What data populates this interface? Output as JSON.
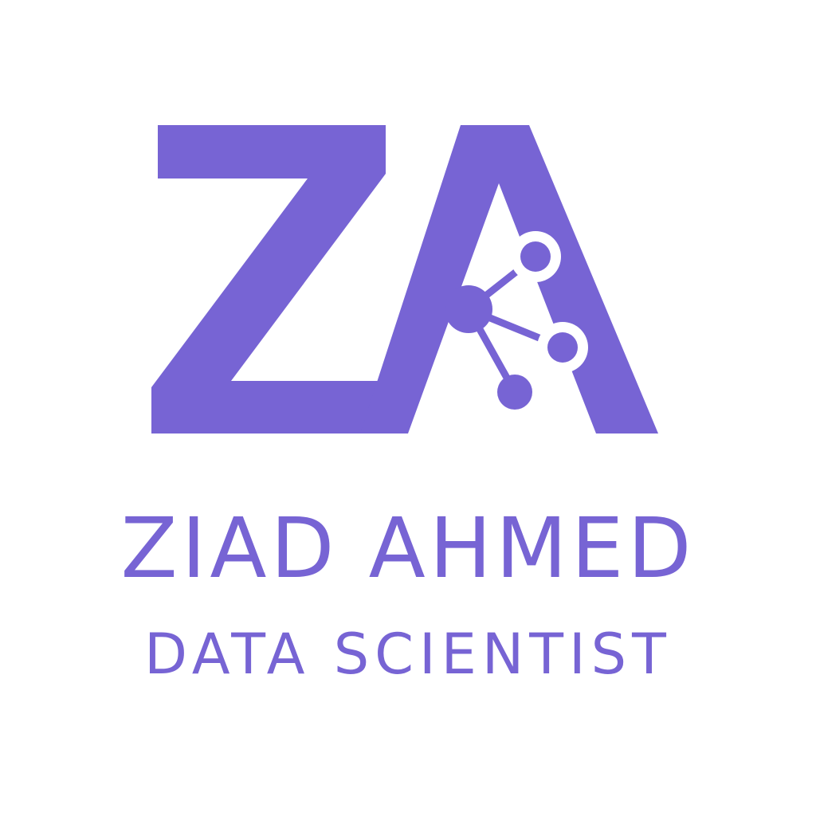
{
  "logo": {
    "monogram": "ZA",
    "icon": "network-nodes-icon",
    "color": "#7764d4",
    "background": "#ffffff"
  },
  "name": "ZIAD AHMED",
  "role": "DATA SCIENTIST"
}
